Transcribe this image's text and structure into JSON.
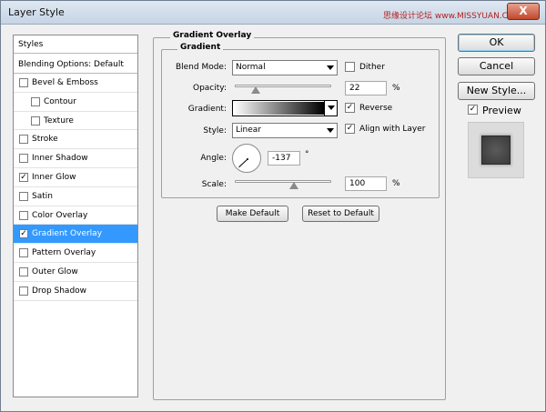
{
  "window": {
    "title": "Layer Style",
    "watermark": "思缘设计论坛 www.MISSYUAN.COM",
    "close_glyph": "X"
  },
  "style_list": {
    "header": "Styles",
    "blending_options": "Blending Options: Default",
    "items": [
      {
        "label": "Bevel & Emboss",
        "checked": false,
        "selected": false,
        "indent": false
      },
      {
        "label": "Contour",
        "checked": false,
        "selected": false,
        "indent": true
      },
      {
        "label": "Texture",
        "checked": false,
        "selected": false,
        "indent": true
      },
      {
        "label": "Stroke",
        "checked": false,
        "selected": false,
        "indent": false
      },
      {
        "label": "Inner Shadow",
        "checked": false,
        "selected": false,
        "indent": false
      },
      {
        "label": "Inner Glow",
        "checked": true,
        "selected": false,
        "indent": false
      },
      {
        "label": "Satin",
        "checked": false,
        "selected": false,
        "indent": false
      },
      {
        "label": "Color Overlay",
        "checked": false,
        "selected": false,
        "indent": false
      },
      {
        "label": "Gradient Overlay",
        "checked": true,
        "selected": true,
        "indent": false
      },
      {
        "label": "Pattern Overlay",
        "checked": false,
        "selected": false,
        "indent": false
      },
      {
        "label": "Outer Glow",
        "checked": false,
        "selected": false,
        "indent": false
      },
      {
        "label": "Drop Shadow",
        "checked": false,
        "selected": false,
        "indent": false
      }
    ],
    "check_glyph": "✓"
  },
  "panel": {
    "group_title": "Gradient Overlay",
    "subgroup_title": "Gradient",
    "blend_mode_label": "Blend Mode:",
    "blend_mode_value": "Normal",
    "dither_label": "Dither",
    "dither_checked": false,
    "opacity_label": "Opacity:",
    "opacity_value": "22",
    "opacity_unit": "%",
    "gradient_label": "Gradient:",
    "reverse_label": "Reverse",
    "reverse_checked": true,
    "style_label": "Style:",
    "style_value": "Linear",
    "align_label": "Align with Layer",
    "align_checked": true,
    "angle_label": "Angle:",
    "angle_value": "-137",
    "angle_unit": "°",
    "scale_label": "Scale:",
    "scale_value": "100",
    "scale_unit": "%",
    "make_default": "Make Default",
    "reset_default": "Reset to Default"
  },
  "actions": {
    "ok": "OK",
    "cancel": "Cancel",
    "new_style": "New Style...",
    "preview_label": "Preview",
    "preview_checked": true
  }
}
